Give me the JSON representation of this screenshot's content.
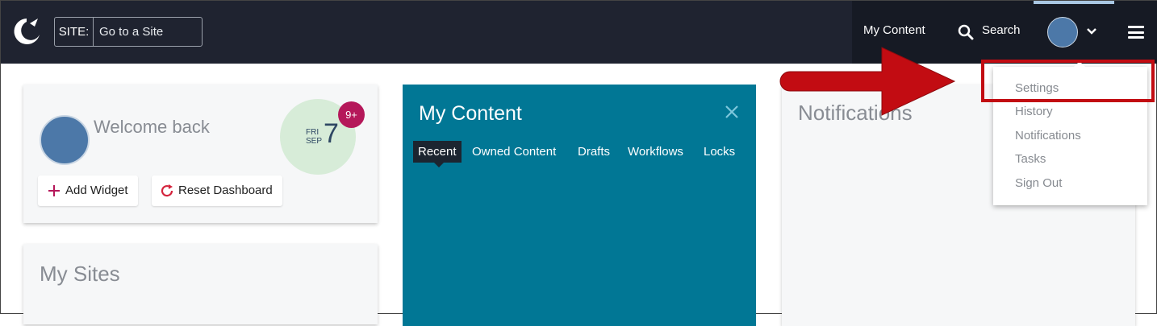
{
  "header": {
    "site_label": "SITE:",
    "site_placeholder": "Go to a Site",
    "nav_my_content": "My Content",
    "nav_search": "Search"
  },
  "welcome": {
    "text": "Welcome back",
    "date_dow": "FRI",
    "date_month": "SEP",
    "date_day": "7",
    "badge": "9+",
    "add_widget_label": "Add Widget",
    "reset_dashboard_label": "Reset Dashboard"
  },
  "my_sites": {
    "title": "My Sites"
  },
  "my_content": {
    "title": "My Content",
    "tabs": [
      "Recent",
      "Owned Content",
      "Drafts",
      "Workflows",
      "Locks"
    ],
    "active_tab": "Recent"
  },
  "notifications": {
    "title": "Notifications"
  },
  "user_menu": {
    "items": [
      "Settings",
      "History",
      "Notifications",
      "Tasks",
      "Sign Out"
    ]
  },
  "colors": {
    "topbar": "#1f2330",
    "panel_teal": "#017795",
    "badge": "#b5185a",
    "highlight": "#c20c12"
  },
  "icons": [
    "logo-icon",
    "search-icon",
    "chevron-down-icon",
    "hamburger-icon",
    "plus-icon",
    "reset-icon",
    "close-icon"
  ]
}
